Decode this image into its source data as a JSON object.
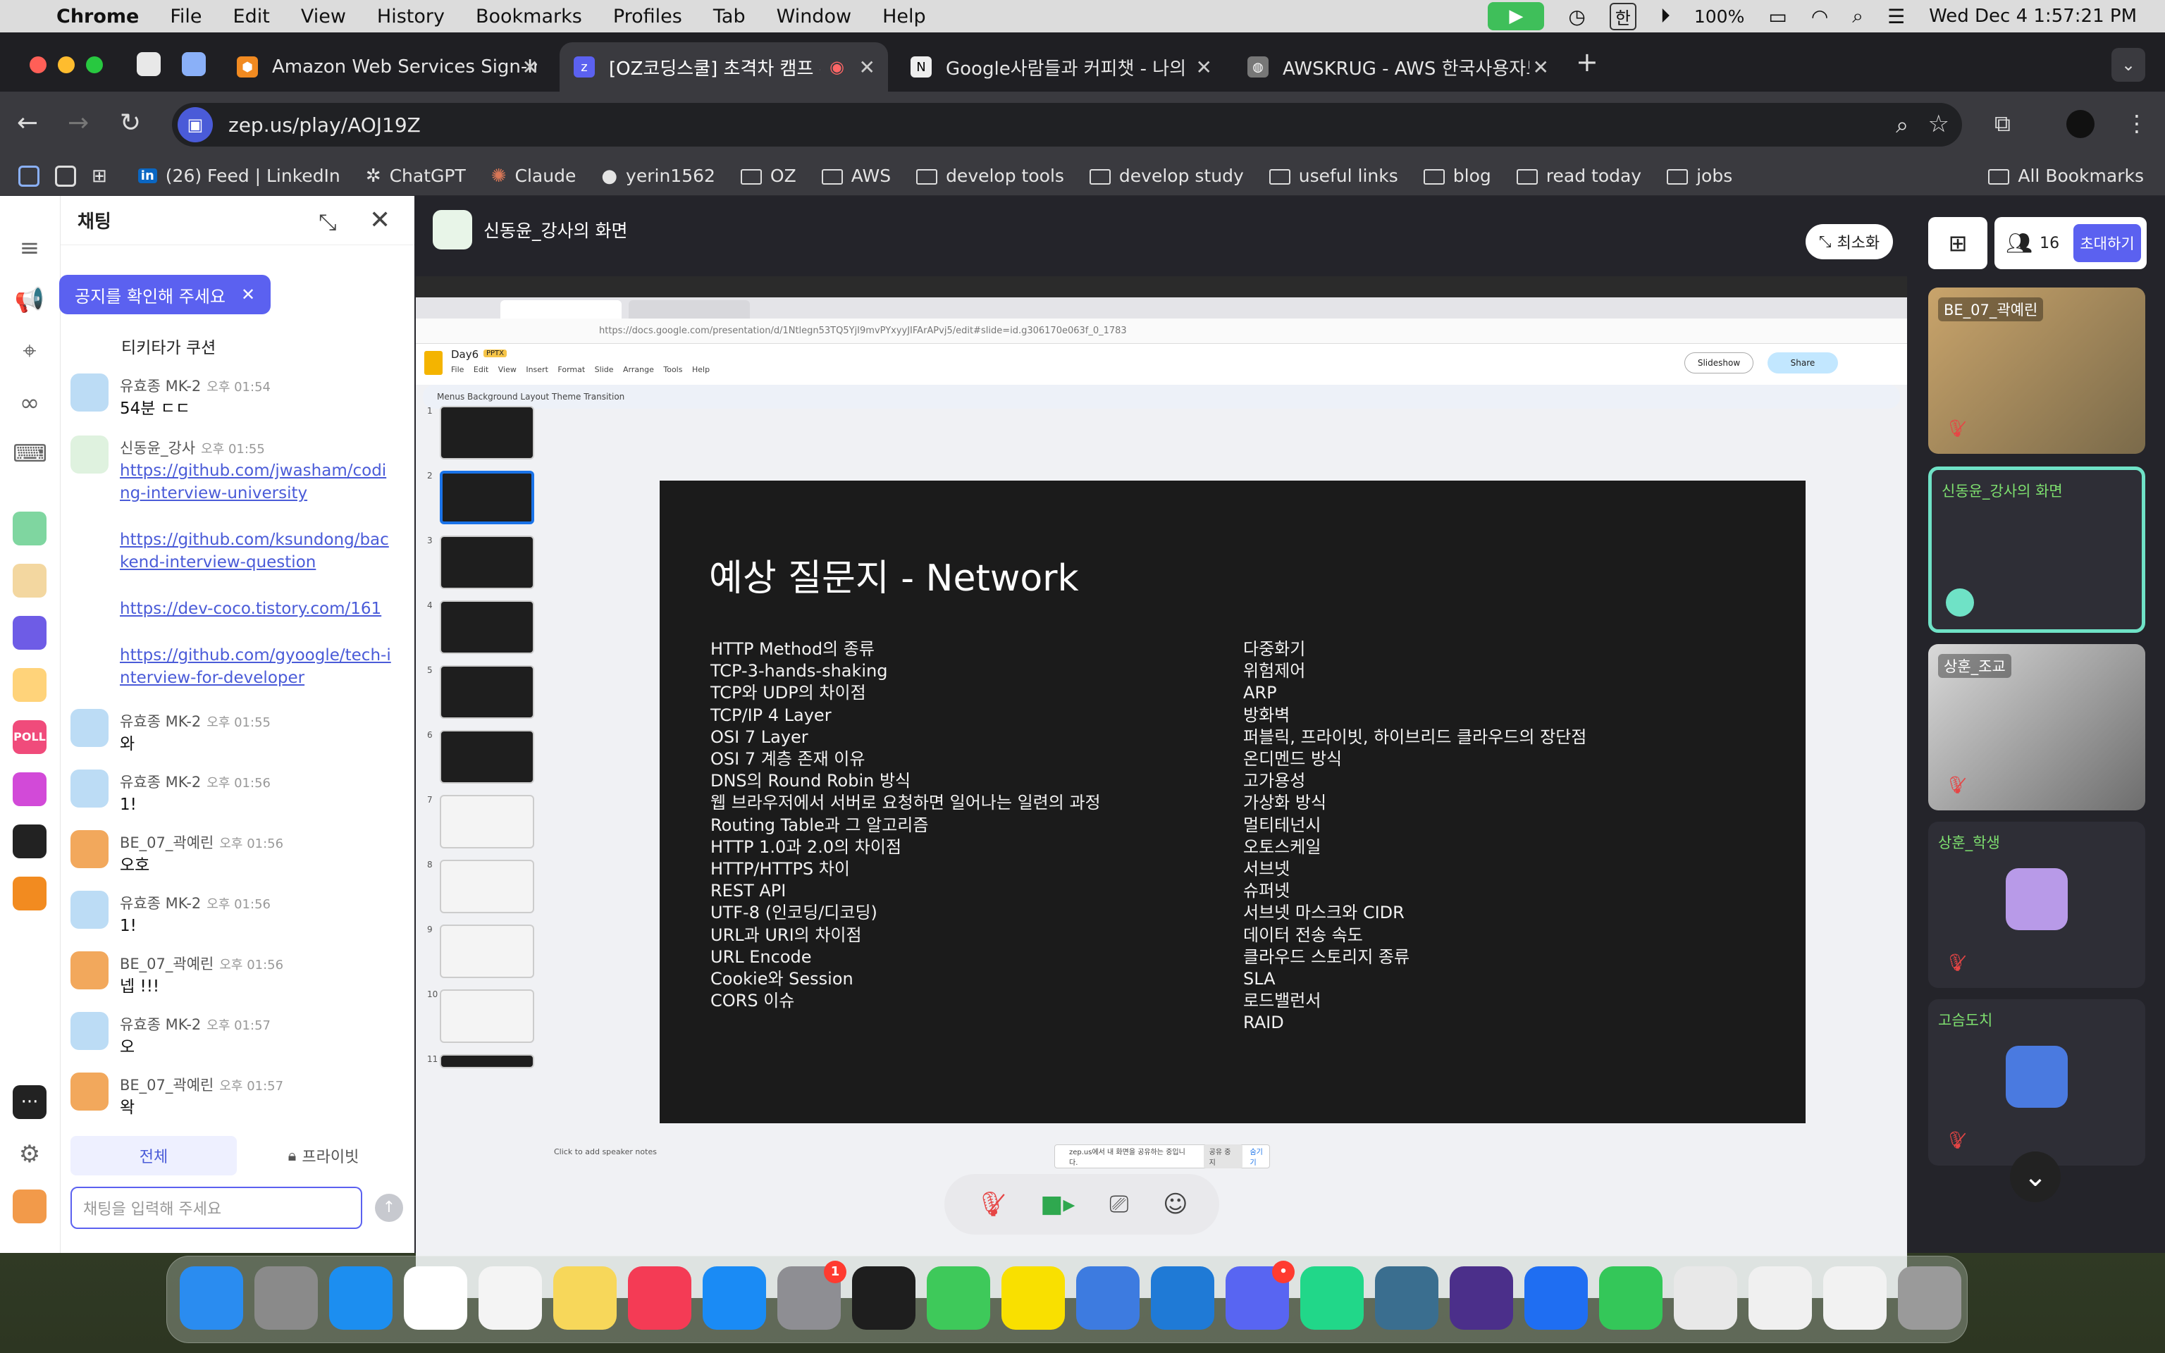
{
  "menubar": {
    "app": "Chrome",
    "items": [
      "File",
      "Edit",
      "View",
      "History",
      "Bookmarks",
      "Profiles",
      "Tab",
      "Window",
      "Help"
    ],
    "input_source": "한",
    "battery": "100%",
    "datetime": "Wed Dec 4  1:57:21 PM"
  },
  "tabs": [
    {
      "title": "Amazon Web Services Sign-In",
      "favicon": "aws-icon"
    },
    {
      "title": "[OZ코딩스쿨] 초격차 캠프 - 백",
      "favicon": "zep-icon",
      "active": true
    },
    {
      "title": "Google사람들과 커피챗 - 나의 커",
      "favicon": "notion-icon"
    },
    {
      "title": "AWSKRUG - AWS 한국사용자모",
      "favicon": "globe-icon"
    }
  ],
  "address": {
    "url": "zep.us/play/AOJ19Z"
  },
  "bookmarks": [
    {
      "label": "(26) Feed | LinkedIn",
      "icon": "linkedin-icon"
    },
    {
      "label": "ChatGPT",
      "icon": "chatgpt-icon"
    },
    {
      "label": "Claude",
      "icon": "claude-icon"
    },
    {
      "label": "yerin1562",
      "icon": "github-icon"
    },
    {
      "label": "OZ",
      "icon": "folder-icon"
    },
    {
      "label": "AWS",
      "icon": "folder-icon"
    },
    {
      "label": "develop tools",
      "icon": "folder-icon"
    },
    {
      "label": "develop study",
      "icon": "folder-icon"
    },
    {
      "label": "useful links",
      "icon": "folder-icon"
    },
    {
      "label": "blog",
      "icon": "folder-icon"
    },
    {
      "label": "read today",
      "icon": "folder-icon"
    },
    {
      "label": "jobs",
      "icon": "folder-icon"
    }
  ],
  "all_bookmarks": "All Bookmarks",
  "chat": {
    "title": "채팅",
    "notice": "공지를 확인해 주세요",
    "first_text": "티키타가 쿠션",
    "messages": [
      {
        "name": "유효종 MK-2",
        "time": "오후 01:54",
        "text": "54분 ㄷㄷ",
        "avatar": "bear-blue"
      },
      {
        "name": "신동윤_강사",
        "time": "오후 01:55",
        "links": [
          "https://github.com/jwasham/coding-interview-university",
          "https://github.com/ksundong/backend-interview-question",
          "https://dev-coco.tistory.com/161",
          "https://github.com/gyoogle/tech-interview-for-developer"
        ],
        "avatar": "teacher"
      },
      {
        "name": "유효종 MK-2",
        "time": "오후 01:55",
        "text": "와",
        "avatar": "bear-blue"
      },
      {
        "name": "유효종 MK-2",
        "time": "오후 01:56",
        "text": "1!",
        "avatar": "bear-blue"
      },
      {
        "name": "BE_07_곽예린",
        "time": "오후 01:56",
        "text": "오호",
        "avatar": "tiger"
      },
      {
        "name": "유효종 MK-2",
        "time": "오후 01:56",
        "text": "1!",
        "avatar": "bear-blue"
      },
      {
        "name": "BE_07_곽예린",
        "time": "오후 01:56",
        "text": "넵 !!!",
        "avatar": "tiger"
      },
      {
        "name": "유효종 MK-2",
        "time": "오후 01:57",
        "text": "오",
        "avatar": "bear-blue"
      },
      {
        "name": "BE_07_곽예린",
        "time": "오후 01:57",
        "text": "왁",
        "avatar": "tiger"
      }
    ],
    "tab_all": "전체",
    "tab_private": "프라이빗",
    "input_placeholder": "채팅을 입력해 주세요"
  },
  "screen": {
    "title": "신동윤_강사의 화면",
    "minimize": "최소화",
    "doc_name": "Day6",
    "doc_badge": "PPTX",
    "menu": [
      "File",
      "Edit",
      "View",
      "Insert",
      "Format",
      "Slide",
      "Arrange",
      "Tools",
      "Help"
    ],
    "tools": "Menus    Background   Layout   Theme   Transition",
    "doc_url": "https://docs.google.com/presentation/d/1Ntlegn53TQ5YjI9mvPYxyyJIFArAPvj5/edit#slide=id.g306170e063f_0_1783",
    "slideshow": "Slideshow",
    "share": "Share",
    "notes": "Click to add speaker notes",
    "share_notice": "zep.us에서 내 화면을 공유하는 중입니다.",
    "share_stop": "공유 중지",
    "share_hide": "숨기기"
  },
  "slide": {
    "title": "예상 질문지 - Network",
    "left": [
      "HTTP Method의 종류",
      "TCP-3-hands-shaking",
      "TCP와 UDP의 차이점",
      "TCP/IP 4 Layer",
      "OSI 7 Layer",
      "OSI 7 계층 존재 이유",
      "DNS의 Round Robin 방식",
      "웹 브라우저에서 서버로 요청하면 일어나는 일련의 과정",
      "Routing Table과 그 알고리즘",
      "HTTP 1.0과 2.0의 차이점",
      "HTTP/HTTPS 차이",
      "REST API",
      "UTF-8 (인코딩/디코딩)",
      "URL과 URI의 차이점",
      "URL Encode",
      "Cookie와 Session",
      "CORS 이슈"
    ],
    "right": [
      "다중화기",
      "위험제어",
      "ARP",
      "방화벽",
      "퍼블릭, 프라이빗, 하이브리드 클라우드의 장단점",
      "온디멘드 방식",
      "고가용성",
      "가상화 방식",
      "멀티테넌시",
      "오토스케일",
      "서브넷",
      "슈퍼넷",
      "서브넷 마스크와 CIDR",
      "데이터 전송 속도",
      "클라우드 스토리지 종류",
      "SLA",
      "로드밸런서",
      "RAID"
    ]
  },
  "thumbnails": [
    "1",
    "2",
    "3",
    "4",
    "5",
    "6",
    "7",
    "8",
    "9",
    "10",
    "11"
  ],
  "participants": {
    "count": "16",
    "invite": "초대하기",
    "tiles": [
      {
        "name": "BE_07_곽예린",
        "type": "camera",
        "muted": true
      },
      {
        "name": "신동윤_강사의 화면",
        "type": "screen",
        "speaking": true
      },
      {
        "name": "상훈_조교",
        "type": "camera",
        "muted": true
      },
      {
        "name": "상훈_학생",
        "type": "avatar",
        "muted": true
      },
      {
        "name": "고슴도치",
        "type": "avatar",
        "muted": true
      }
    ]
  },
  "dock": [
    {
      "name": "finder-icon",
      "color": "#2a8cf0"
    },
    {
      "name": "launchpad-icon",
      "color": "#8a8a8a"
    },
    {
      "name": "safari-icon",
      "color": "#1c8ef0"
    },
    {
      "name": "chrome-icon",
      "color": "#ffffff"
    },
    {
      "name": "photos-icon",
      "color": "#f4f4f4"
    },
    {
      "name": "notes-icon",
      "color": "#f7d75a"
    },
    {
      "name": "music-icon",
      "color": "#f43b55"
    },
    {
      "name": "appstore-icon",
      "color": "#1a8bf5"
    },
    {
      "name": "settings-icon",
      "color": "#8e8e93",
      "badge": "1"
    },
    {
      "name": "terminal-icon",
      "color": "#1e1e1e"
    },
    {
      "name": "facetime-icon",
      "color": "#3ec95a"
    },
    {
      "name": "kakaotalk-icon",
      "color": "#f9e000"
    },
    {
      "name": "testflight-icon",
      "color": "#3d7be0"
    },
    {
      "name": "vscode-icon",
      "color": "#1f7ad6"
    },
    {
      "name": "discord-icon",
      "color": "#5865f2",
      "badge": "•"
    },
    {
      "name": "pycharm-icon",
      "color": "#21d789"
    },
    {
      "name": "mysql-workbench-icon",
      "color": "#3a6e8f"
    },
    {
      "name": "obsidian-icon",
      "color": "#4b2f8a"
    },
    {
      "name": "zep-icon",
      "color": "#1f6ef2"
    },
    {
      "name": "numbers-icon",
      "color": "#34c759"
    },
    {
      "name": "python-launcher-icon",
      "color": "#e8e8e8"
    },
    {
      "name": "textedit-icon",
      "color": "#f0f0f0"
    },
    {
      "name": "shell-file-icon",
      "color": "#f2f2f2"
    },
    {
      "name": "trash-icon",
      "color": "#9a9a9a"
    }
  ]
}
